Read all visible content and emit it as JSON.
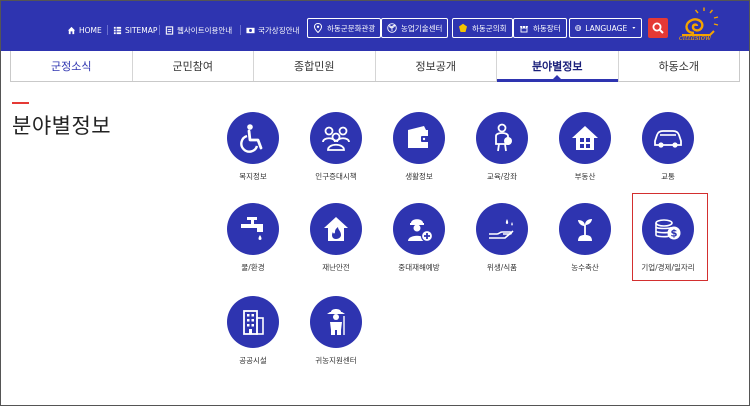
{
  "header": {
    "utility_links": [
      {
        "label": "HOME",
        "icon": "home-icon"
      },
      {
        "label": "SITEMAP",
        "icon": "sitemap-icon"
      },
      {
        "label": "웹사이트이용안내",
        "icon": "document-icon"
      },
      {
        "label": "국가상징안내",
        "icon": "flag-icon"
      }
    ],
    "site_buttons": [
      {
        "label": "하동군문화관광",
        "icon": "location-pin-icon"
      },
      {
        "label": "농업기술센터",
        "icon": "sprout-icon"
      },
      {
        "label": "하동군의회",
        "icon": "emblem-icon"
      },
      {
        "label": "하동장터",
        "icon": "market-icon"
      }
    ],
    "language_label": "LANGUAGE",
    "logo_text": "cittaslow",
    "colors": {
      "brand": "#2e34b0",
      "search": "#e53935",
      "highlight": "#d32f2f"
    }
  },
  "nav": {
    "items": [
      "군정소식",
      "군민참여",
      "종합민원",
      "정보공개",
      "분야별정보",
      "하동소개"
    ],
    "active_index": 4
  },
  "page": {
    "title": "분야별정보"
  },
  "categories": [
    {
      "label": "복지정보",
      "icon": "wheelchair-icon"
    },
    {
      "label": "인구증대시책",
      "icon": "people-group-icon"
    },
    {
      "label": "생활정보",
      "icon": "wallet-icon"
    },
    {
      "label": "교육/강좌",
      "icon": "student-icon"
    },
    {
      "label": "부동산",
      "icon": "house-icon"
    },
    {
      "label": "교통",
      "icon": "car-icon"
    },
    {
      "label": "물/환경",
      "icon": "faucet-icon"
    },
    {
      "label": "재난안전",
      "icon": "fire-house-icon"
    },
    {
      "label": "중대재해예방",
      "icon": "worker-plus-icon"
    },
    {
      "label": "위생/식품",
      "icon": "hand-wash-icon"
    },
    {
      "label": "농수축산",
      "icon": "plant-icon"
    },
    {
      "label": "기업/경제/일자리",
      "icon": "coin-icon"
    },
    {
      "label": "공공시설",
      "icon": "building-icon"
    },
    {
      "label": "귀농지원센터",
      "icon": "farmer-icon"
    }
  ]
}
